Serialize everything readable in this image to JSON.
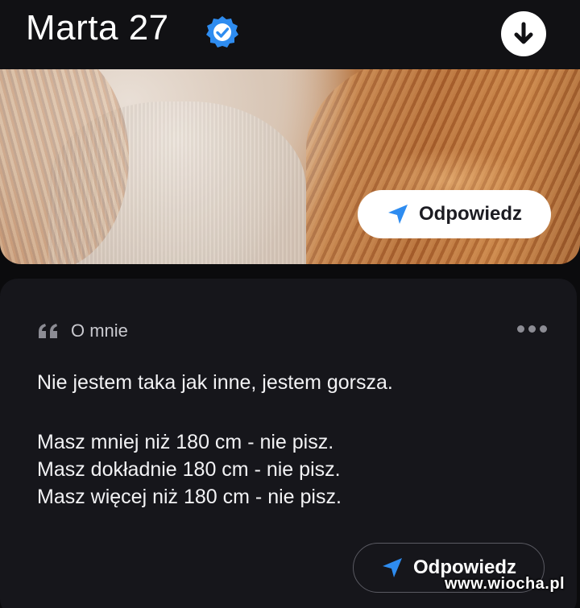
{
  "profile": {
    "name_age": "Marta 27",
    "verified_icon": "verified-badge-icon"
  },
  "header": {
    "download_icon": "arrow-down-icon"
  },
  "photo": {
    "reply_label": "Odpowiedz",
    "reply_icon": "send-icon"
  },
  "about": {
    "quote_icon": "quote-icon",
    "title": "O mnie",
    "more_icon": "more-dots-icon",
    "lines": [
      "Nie jestem taka jak inne, jestem gorsza.",
      "Masz mniej niż 180 cm - nie pisz.",
      "Masz dokładnie 180 cm - nie pisz.",
      "Masz więcej niż 180 cm - nie pisz."
    ],
    "reply_label": "Odpowiedz"
  },
  "watermark": "www.wiocha.pl",
  "colors": {
    "accent_blue": "#2e8cf0",
    "background": "#0b0b0d",
    "card": "#16161b"
  }
}
